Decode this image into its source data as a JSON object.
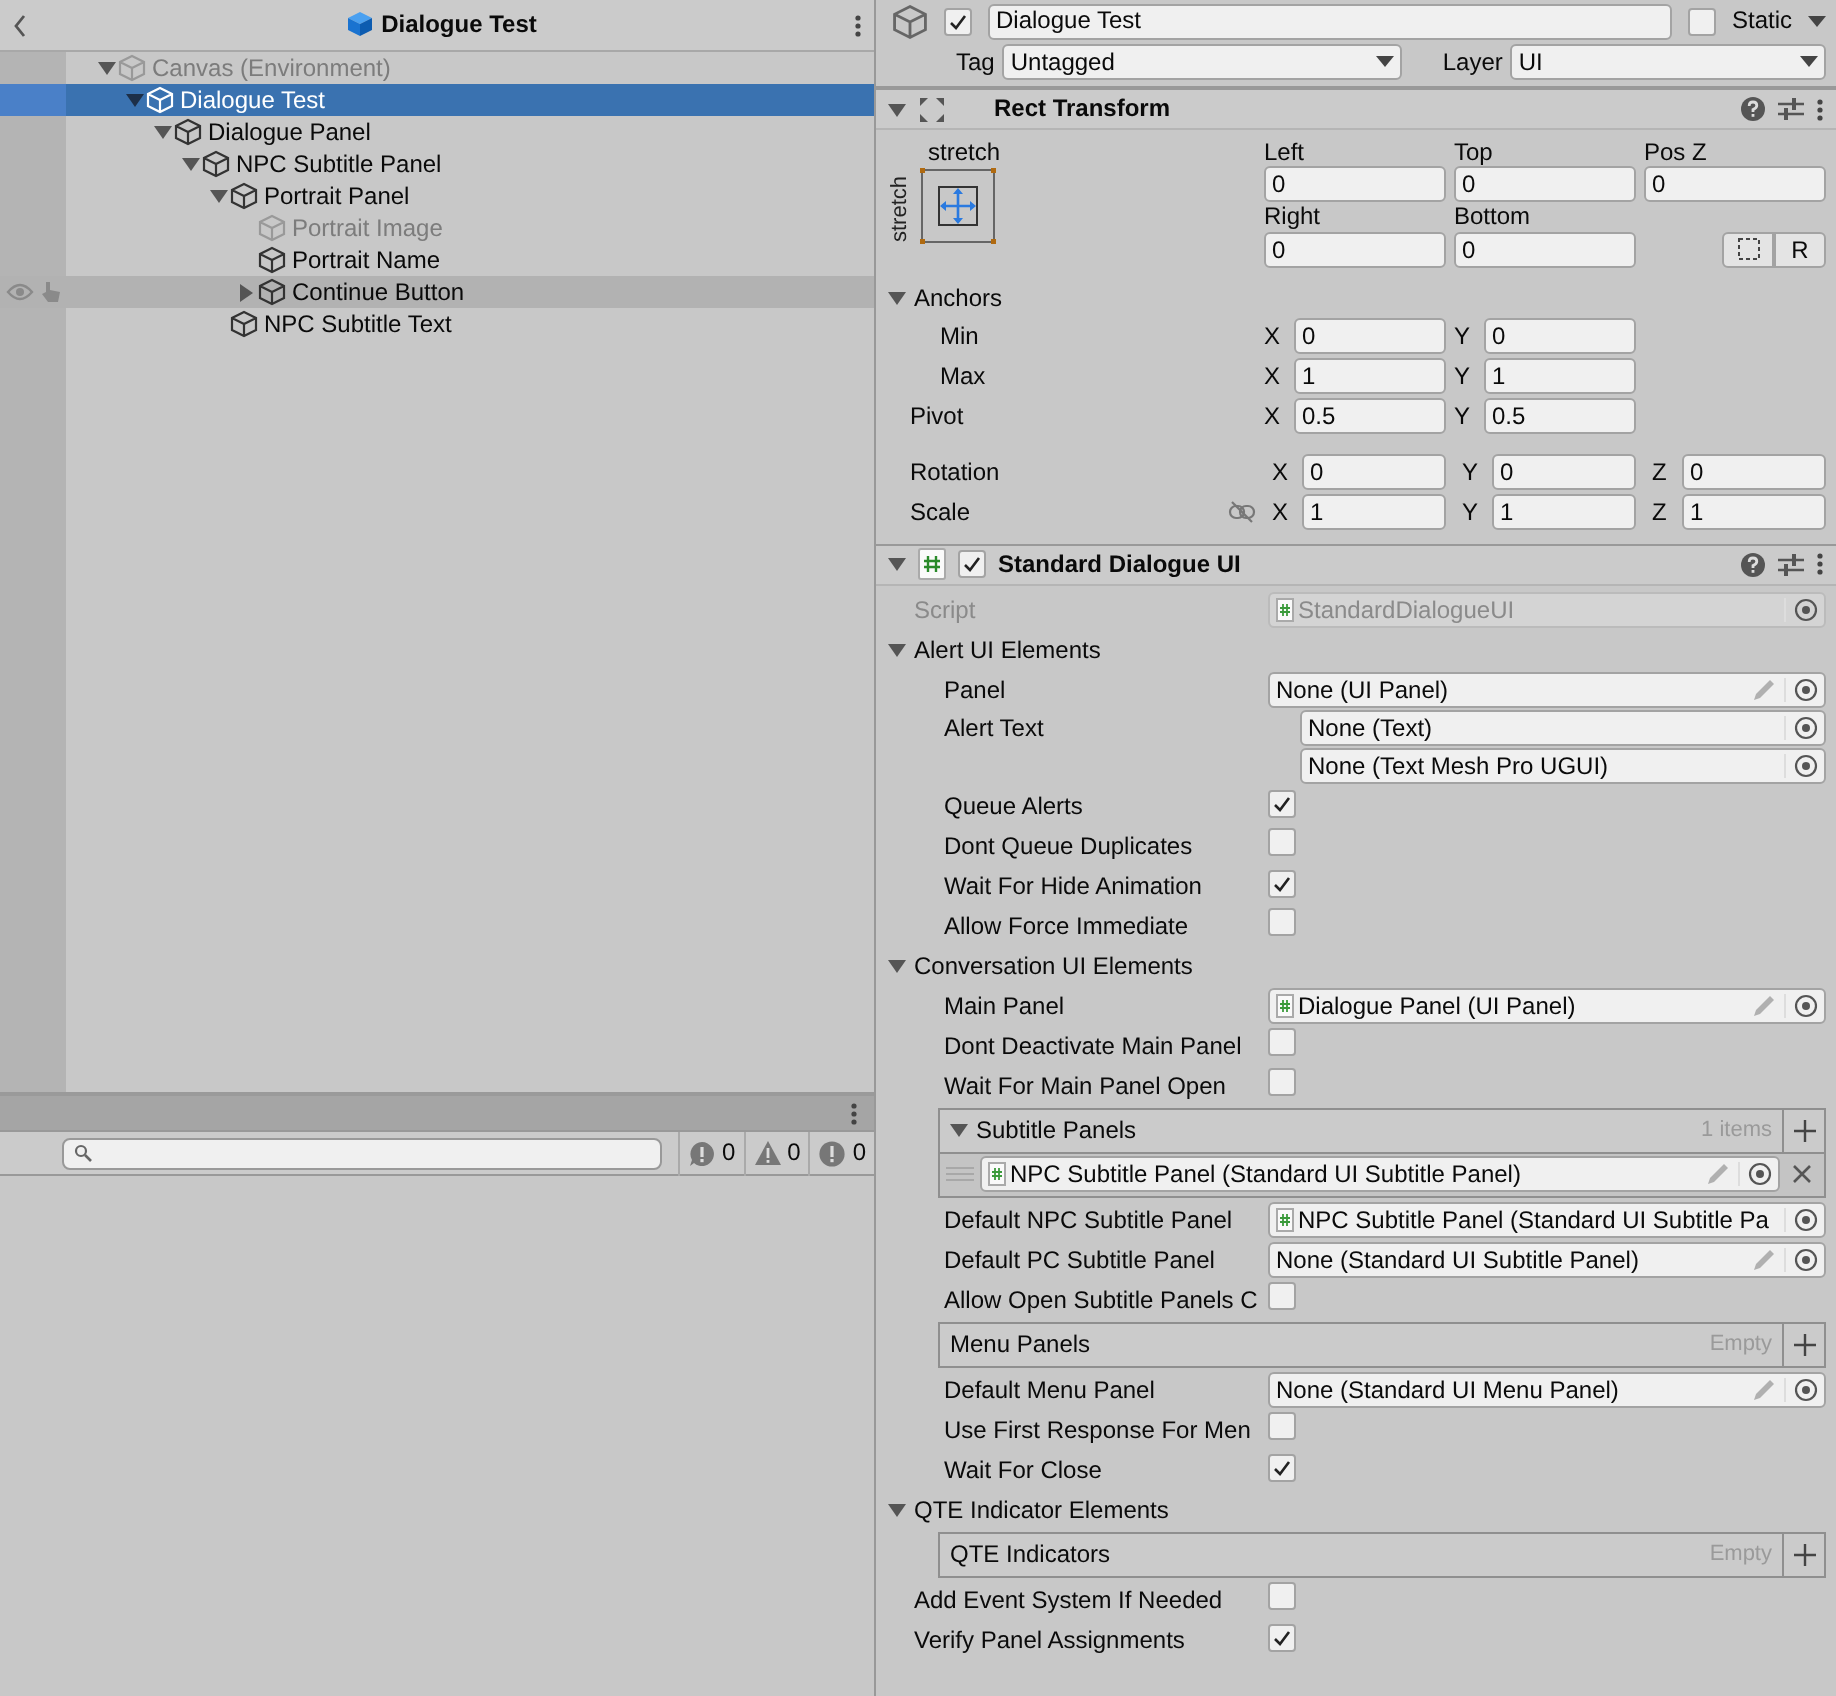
{
  "hierarchy": {
    "title": "Dialogue Test",
    "items": [
      {
        "label": "Canvas (Environment)",
        "active": false,
        "expanded": true,
        "selected": false,
        "hovered": false,
        "children": [
          {
            "label": "Dialogue Test",
            "active": true,
            "expanded": true,
            "selected": true,
            "hovered": false,
            "children": [
              {
                "label": "Dialogue Panel",
                "active": true,
                "expanded": true,
                "selected": false,
                "hovered": false,
                "children": [
                  {
                    "label": "NPC Subtitle Panel",
                    "active": true,
                    "expanded": true,
                    "selected": false,
                    "hovered": false,
                    "children": [
                      {
                        "label": "Portrait Panel",
                        "active": true,
                        "expanded": true,
                        "selected": false,
                        "hovered": false,
                        "children": [
                          {
                            "label": "Portrait Image",
                            "active": false,
                            "selected": false,
                            "hovered": false
                          },
                          {
                            "label": "Portrait Name",
                            "active": true,
                            "selected": false,
                            "hovered": false
                          },
                          {
                            "label": "Continue Button",
                            "active": true,
                            "expanded": false,
                            "selected": false,
                            "hovered": true
                          }
                        ]
                      },
                      {
                        "label": "NPC Subtitle Text",
                        "active": true,
                        "selected": false,
                        "hovered": false
                      }
                    ]
                  }
                ]
              }
            ]
          }
        ]
      }
    ]
  },
  "console": {
    "counts": [
      {
        "kind": "info",
        "count": "0"
      },
      {
        "kind": "warning",
        "count": "0"
      },
      {
        "kind": "error",
        "count": "0"
      }
    ]
  },
  "inspector": {
    "header": {
      "active": true,
      "name": "Dialogue Test",
      "static_label": "Static",
      "static": false,
      "tag_label": "Tag",
      "tag": "Untagged",
      "layer_label": "Layer",
      "layer": "UI"
    },
    "rect_transform": {
      "title": "Rect Transform",
      "preset_labels": [
        "stretch",
        "stretch"
      ],
      "offsets": [
        {
          "label": "Left",
          "value": "0"
        },
        {
          "label": "Top",
          "value": "0"
        },
        {
          "label": "Pos Z",
          "value": "0"
        },
        {
          "label": "Right",
          "value": "0"
        },
        {
          "label": "Bottom",
          "value": "0"
        }
      ],
      "raw_button": "R",
      "anchors": {
        "label": "Anchors",
        "expanded": true,
        "rows": [
          {
            "label": "Min",
            "fields": [
              {
                "axis": "X",
                "value": "0"
              },
              {
                "axis": "Y",
                "value": "0"
              }
            ]
          },
          {
            "label": "Max",
            "fields": [
              {
                "axis": "X",
                "value": "1"
              },
              {
                "axis": "Y",
                "value": "1"
              }
            ]
          }
        ]
      },
      "vectors": [
        {
          "kind": "vector2",
          "label": "Pivot",
          "fields": [
            {
              "axis": "X",
              "value": "0.5"
            },
            {
              "axis": "Y",
              "value": "0.5"
            }
          ]
        },
        {
          "kind": "vector3",
          "label": "Rotation",
          "fields": [
            {
              "axis": "X",
              "value": "0"
            },
            {
              "axis": "Y",
              "value": "0"
            },
            {
              "axis": "Z",
              "value": "0"
            }
          ]
        },
        {
          "kind": "vector3",
          "label": "Scale",
          "fields": [
            {
              "axis": "X",
              "value": "1"
            },
            {
              "axis": "Y",
              "value": "1"
            },
            {
              "axis": "Z",
              "value": "1"
            }
          ]
        }
      ]
    },
    "component": {
      "title": "Standard Dialogue UI",
      "enabled": true,
      "rows": [
        {
          "kind": "object",
          "label": "Script",
          "value": "StandardDialogueUI",
          "disabled": true,
          "script_icon": true,
          "pencil": false
        },
        {
          "kind": "foldout",
          "label": "Alert UI Elements",
          "expanded": true,
          "children": [
            {
              "kind": "object",
              "label": "Panel",
              "value": "None (UI Panel)",
              "disabled": false,
              "script_icon": false,
              "pencil": true
            },
            {
              "kind": "object_stack",
              "label": "Alert Text",
              "values": [
                "None (Text)",
                "None (Text Mesh Pro UGUI)"
              ]
            },
            {
              "kind": "checkbox",
              "label": "Queue Alerts",
              "checked": true
            },
            {
              "kind": "checkbox",
              "label": "Dont Queue Duplicates",
              "checked": false
            },
            {
              "kind": "checkbox",
              "label": "Wait For Hide Animation",
              "checked": true
            },
            {
              "kind": "checkbox",
              "label": "Allow Force Immediate",
              "checked": false
            }
          ]
        },
        {
          "kind": "foldout",
          "label": "Conversation UI Elements",
          "expanded": true,
          "children": [
            {
              "kind": "object",
              "label": "Main Panel",
              "value": "Dialogue Panel (UI Panel)",
              "disabled": false,
              "script_icon": true,
              "pencil": true
            },
            {
              "kind": "checkbox",
              "label": "Dont Deactivate Main Panel",
              "checked": false
            },
            {
              "kind": "checkbox",
              "label": "Wait For Main Panel Open",
              "checked": false
            },
            {
              "kind": "list",
              "title": "Subtitle Panels",
              "expanded": true,
              "count": "1 items",
              "items": [
                "NPC Subtitle Panel (Standard UI Subtitle Panel)"
              ]
            },
            {
              "kind": "object",
              "label": "Default NPC Subtitle Panel",
              "value": "NPC Subtitle Panel (Standard UI Subtitle Pa",
              "disabled": false,
              "script_icon": true,
              "pencil": false
            },
            {
              "kind": "object",
              "label": "Default PC Subtitle Panel",
              "value": "None (Standard UI Subtitle Panel)",
              "disabled": false,
              "script_icon": false,
              "pencil": true
            },
            {
              "kind": "checkbox",
              "label": "Allow Open Subtitle Panels C",
              "checked": false
            },
            {
              "kind": "list",
              "title": "Menu Panels",
              "count": "Empty"
            },
            {
              "kind": "object",
              "label": "Default Menu Panel",
              "value": "None (Standard UI Menu Panel)",
              "disabled": false,
              "script_icon": false,
              "pencil": true
            },
            {
              "kind": "checkbox",
              "label": "Use First Response For Men",
              "checked": false
            },
            {
              "kind": "checkbox",
              "label": "Wait For Close",
              "checked": true
            }
          ]
        },
        {
          "kind": "foldout",
          "label": "QTE Indicator Elements",
          "expanded": true,
          "children": [
            {
              "kind": "list",
              "title": "QTE Indicators",
              "count": "Empty"
            }
          ]
        },
        {
          "kind": "checkbox",
          "label": "Add Event System If Needed",
          "checked": false
        },
        {
          "kind": "checkbox",
          "label": "Verify Panel Assignments",
          "checked": true
        }
      ]
    }
  }
}
